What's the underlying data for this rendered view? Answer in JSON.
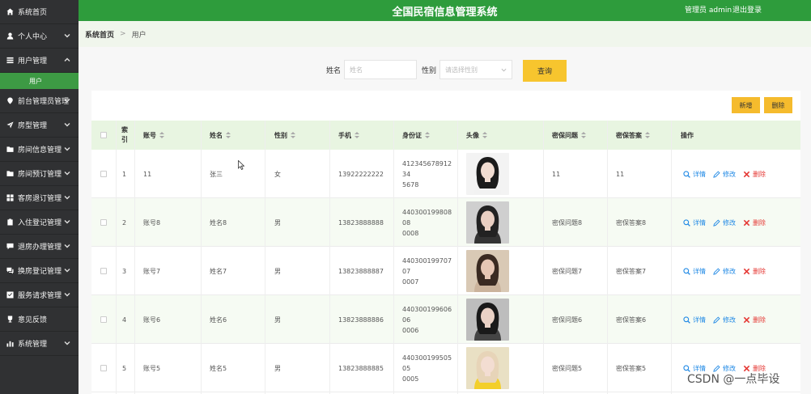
{
  "header": {
    "title": "全国民宿信息管理系统",
    "user": "管理员 admin",
    "logout": "退出登录"
  },
  "sidebar": {
    "items": [
      {
        "label": "系统首页",
        "icon": "home-icon"
      },
      {
        "label": "个人中心",
        "icon": "person-icon"
      },
      {
        "label": "用户管理",
        "icon": "list-icon",
        "sub": "用户"
      },
      {
        "label": "前台管理员管理",
        "icon": "pin-icon"
      },
      {
        "label": "房型管理",
        "icon": "plane-icon"
      },
      {
        "label": "房间信息管理",
        "icon": "folder-icon"
      },
      {
        "label": "房间预订管理",
        "icon": "folder-icon"
      },
      {
        "label": "客房退订管理",
        "icon": "grid-icon"
      },
      {
        "label": "入住登记管理",
        "icon": "clipboard-icon"
      },
      {
        "label": "退房办理管理",
        "icon": "comment-icon"
      },
      {
        "label": "换房登记管理",
        "icon": "comments-icon"
      },
      {
        "label": "服务请求管理",
        "icon": "check-icon"
      },
      {
        "label": "意见反馈",
        "icon": "trophy-icon"
      },
      {
        "label": "系统管理",
        "icon": "bar-chart-icon"
      }
    ]
  },
  "breadcrumb": {
    "home": "系统首页",
    "sep": ">",
    "current": "用户"
  },
  "search": {
    "name_label": "姓名",
    "name_placeholder": "姓名",
    "gender_label": "性别",
    "gender_placeholder": "请选择性别",
    "query_button": "查询"
  },
  "toolbar": {
    "add_button": "新增",
    "delete_button": "删除"
  },
  "table": {
    "headers": {
      "index": "索引",
      "account": "账号",
      "name": "姓名",
      "gender": "性别",
      "phone": "手机",
      "id_card": "身份证",
      "avatar": "头像",
      "question": "密保问题",
      "answer": "密保答案",
      "actions": "操作"
    },
    "actions": {
      "detail": "详情",
      "edit": "修改",
      "delete": "删除"
    },
    "rows": [
      {
        "index": "1",
        "account": "11",
        "name": "张三",
        "gender": "女",
        "phone": "13922222222",
        "id_line1": "41234567891234",
        "id_line2": "5678",
        "question": "11",
        "answer": "11"
      },
      {
        "index": "2",
        "account": "账号8",
        "name": "姓名8",
        "gender": "男",
        "phone": "13823888888",
        "id_line1": "44030019980808",
        "id_line2": "0008",
        "question": "密保问题8",
        "answer": "密保答案8"
      },
      {
        "index": "3",
        "account": "账号7",
        "name": "姓名7",
        "gender": "男",
        "phone": "13823888887",
        "id_line1": "44030019970707",
        "id_line2": "0007",
        "question": "密保问题7",
        "answer": "密保答案7"
      },
      {
        "index": "4",
        "account": "账号6",
        "name": "姓名6",
        "gender": "男",
        "phone": "13823888886",
        "id_line1": "44030019960606",
        "id_line2": "0006",
        "question": "密保问题6",
        "answer": "密保答案6"
      },
      {
        "index": "5",
        "account": "账号5",
        "name": "姓名5",
        "gender": "男",
        "phone": "13823888885",
        "id_line1": "44030019950505",
        "id_line2": "0005",
        "question": "密保问题5",
        "answer": "密保答案5"
      }
    ]
  },
  "watermark": "CSDN @一点毕设",
  "colors": {
    "header": "#2e9c3c",
    "sidebar": "#303133",
    "accent_yellow": "#f7c52e",
    "link_blue": "#1e88e5",
    "delete_red": "#e53935"
  }
}
